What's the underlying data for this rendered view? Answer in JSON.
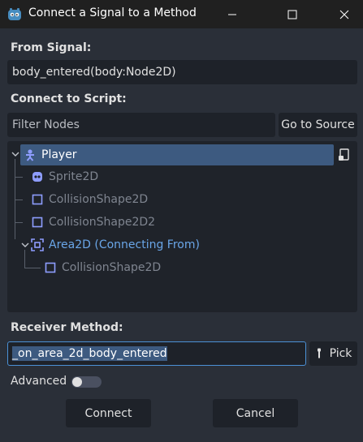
{
  "window": {
    "title": "Connect a Signal to a Method"
  },
  "signal": {
    "label": "From Signal:",
    "value": "body_entered(body:Node2D)"
  },
  "script": {
    "label": "Connect to Script:",
    "filter_placeholder": "Filter Nodes",
    "go_to_source": "Go to Source"
  },
  "tree": {
    "items": [
      {
        "label": "Player",
        "icon": "character-body-icon",
        "selected": true
      },
      {
        "label": "Sprite2D",
        "icon": "sprite-icon"
      },
      {
        "label": "CollisionShape2D",
        "icon": "collision-shape-icon"
      },
      {
        "label": "CollisionShape2D2",
        "icon": "collision-shape-icon"
      },
      {
        "label": "Area2D (Connecting From)",
        "icon": "area-icon",
        "highlight": true
      },
      {
        "label": "CollisionShape2D",
        "icon": "collision-shape-icon"
      }
    ]
  },
  "receiver": {
    "label": "Receiver Method:",
    "value": "_on_area_2d_body_entered",
    "pick": "Pick"
  },
  "advanced": {
    "label": "Advanced",
    "enabled": false
  },
  "actions": {
    "connect": "Connect",
    "cancel": "Cancel"
  },
  "colors": {
    "accent": "#4b91d6",
    "selected_row": "#3d5a80",
    "highlight_text": "#6aa6e8",
    "dim_text": "#7f8590",
    "icon_purple": "#8e9dff"
  }
}
